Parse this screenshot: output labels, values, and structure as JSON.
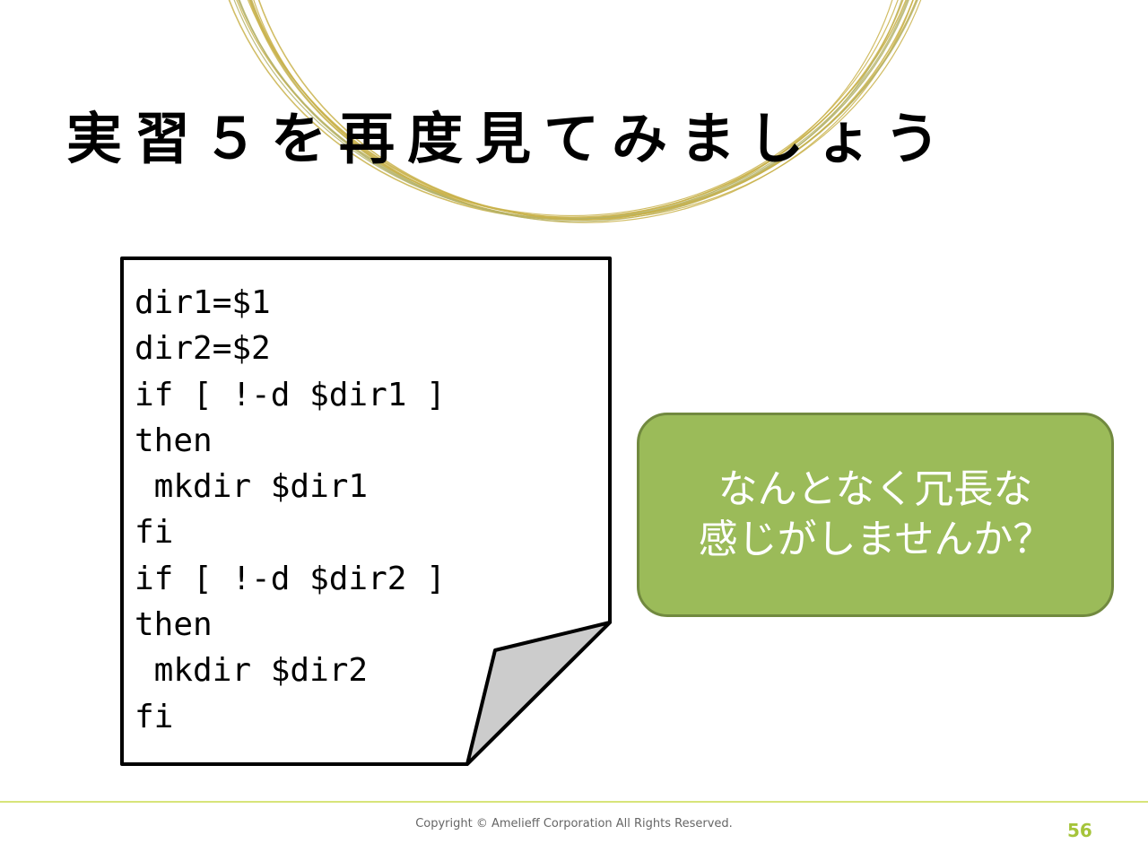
{
  "title": "実習５を再度見てみましょう",
  "code_lines": [
    "dir1=$1",
    "dir2=$2",
    "if [ !-d $dir1 ]",
    "then",
    " mkdir $dir1",
    "fi",
    "if [ !-d $dir2 ]",
    "then",
    " mkdir $dir2",
    "fi"
  ],
  "callout": {
    "line1": "なんとなく冗長な",
    "line2": "感じがしませんか？"
  },
  "footer": {
    "copyright": "Copyright © Amelieff Corporation All Rights Reserved.",
    "page_number": "56"
  },
  "colors": {
    "callout_fill": "#9bbb59",
    "callout_border": "#71893f",
    "footer_rule": "#d7e47a",
    "page_number": "#a5c43a",
    "ring_lines": "#c9b24a"
  }
}
